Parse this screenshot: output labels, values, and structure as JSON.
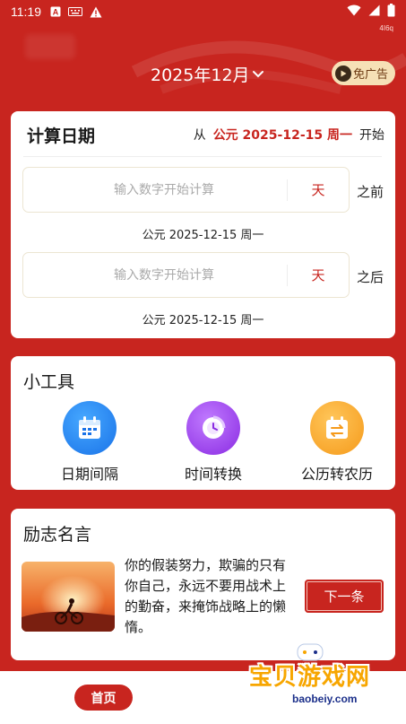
{
  "status_bar": {
    "time": "11:19",
    "extra_text": "4I6q"
  },
  "header": {
    "month_label": "2025年12月",
    "ad_free_label": "免广告"
  },
  "calculator": {
    "title": "计算日期",
    "from_prefix": "从",
    "start_date": "公元 2025-12-15 周一",
    "from_suffix": "开始",
    "before": {
      "placeholder": "输入数字开始计算",
      "value": "",
      "unit": "天",
      "suffix": "之前",
      "result": "公元 2025-12-15 周一"
    },
    "after": {
      "placeholder": "输入数字开始计算",
      "value": "",
      "unit": "天",
      "suffix": "之后",
      "result": "公元 2025-12-15 周一"
    }
  },
  "tools": {
    "title": "小工具",
    "items": [
      {
        "label": "日期间隔",
        "icon": "calendar-icon"
      },
      {
        "label": "时间转换",
        "icon": "clock-cycle-icon"
      },
      {
        "label": "公历转农历",
        "icon": "calendar-convert-icon"
      }
    ]
  },
  "quote": {
    "title": "励志名言",
    "text": "你的假装努力，欺骗的只有你自己，永远不要用战术上的勤奋，来掩饰战略上的懒惰。",
    "next_label": "下一条"
  },
  "bottom_nav": {
    "home_label": "首页"
  },
  "watermark": {
    "title": "宝贝游戏网",
    "url": "baobeiy.com"
  },
  "colors": {
    "brand_red": "#c8251f",
    "accent_gold": "#f6e0b6"
  }
}
